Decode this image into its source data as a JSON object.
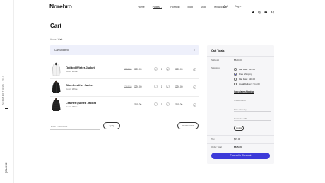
{
  "header": {
    "logo": "Norebro",
    "nav": [
      {
        "label": "Home",
        "active": false
      },
      {
        "label": "Pages",
        "active": true,
        "dropdown": true
      },
      {
        "label": "Portfolio",
        "active": false
      },
      {
        "label": "Blog",
        "active": false
      },
      {
        "label": "Shop",
        "active": false
      },
      {
        "label": "My Account",
        "active": false
      }
    ],
    "cart_count": "0",
    "language": "Eng",
    "social_icons": [
      "twitter-icon",
      "instagram-icon",
      "dribbble-icon"
    ],
    "accent_color": "#3d3ad9"
  },
  "rail": {
    "text": "NOREBRO THEME · 2017",
    "close": "CLOSE"
  },
  "page": {
    "title": "Cart",
    "breadcrumb": {
      "home": "Home",
      "sep": "/",
      "current": "Cart"
    },
    "notice": "Cart updated."
  },
  "items": [
    {
      "name": "Quilted Winter Jacket",
      "color": "Color: White",
      "old_price": "$222.00",
      "price": "$185.00",
      "qty": "1",
      "subtotal": "$185.00"
    },
    {
      "name": "Biker Leather Jacket",
      "color": "Color: White",
      "old_price": "$248.00",
      "price": "$220.00",
      "qty": "1",
      "subtotal": "$220.00"
    },
    {
      "name": "Leather Quilted Jacket",
      "color": "Color: White",
      "old_price": "",
      "price": "$115.00",
      "qty": "1",
      "subtotal": "$115.00"
    }
  ],
  "cart_actions": {
    "promo_placeholder": "Enter Promocode",
    "apply": "Apply",
    "update": "Update Cart"
  },
  "totals": {
    "title": "Cart Totals",
    "subtotal_label": "Subtotal",
    "subtotal": "$520.00",
    "shipping_label": "Shipping",
    "shipping_options": [
      {
        "label": "Flat Rate: $15.00",
        "selected": false
      },
      {
        "label": "Free Shipping",
        "selected": true
      },
      {
        "label": "Flat Rate: $30.00",
        "selected": false
      },
      {
        "label": "Local Delivery: $15.00",
        "selected": false
      }
    ],
    "calculate": "Calculate shipping",
    "country": "United States",
    "state": "State / County",
    "zip": "Postcode / ZIP",
    "update": "Update",
    "tax_label": "Tax",
    "tax": "$15.00",
    "total_label": "Order Total",
    "total": "$535.00",
    "checkout": "Proceed to Checkout"
  }
}
